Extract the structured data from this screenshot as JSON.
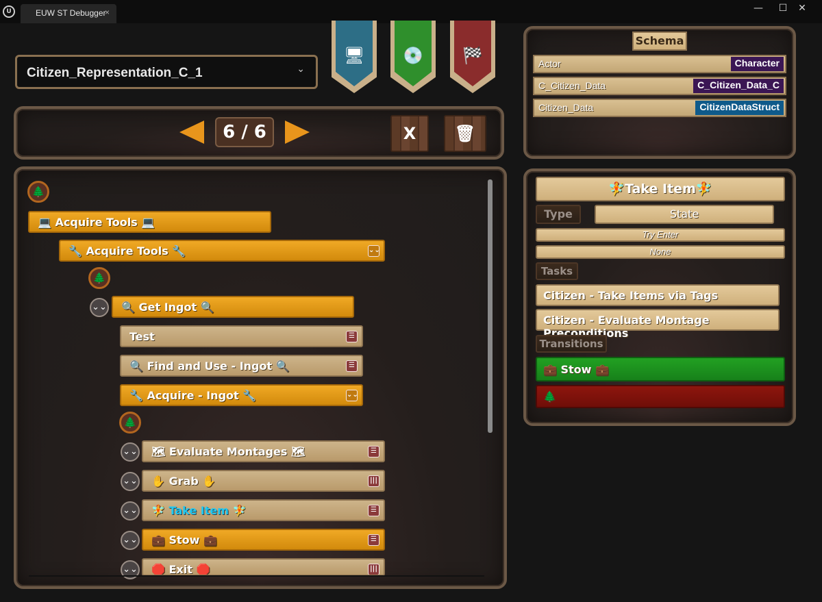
{
  "window": {
    "tab_title": "EUW ST Debugger",
    "tab_close": "×",
    "minimize": "—",
    "maximize": "☐",
    "close": "✕"
  },
  "selector": {
    "value": "Citizen_Representation_C_1",
    "chevron": "⌄"
  },
  "banners": [
    {
      "icon": "monitor-icon",
      "color": "#2d6e86",
      "glyph": "🖥"
    },
    {
      "icon": "disc-icon",
      "color": "#2f8f2c",
      "glyph": "💿"
    },
    {
      "icon": "checkered-flag-icon",
      "color": "#8a2c2c",
      "glyph": "🏁"
    }
  ],
  "nav": {
    "counter": "6 / 6",
    "clear_label": "X",
    "trash_glyph": "🗑"
  },
  "tree": {
    "root_glyph": "🌲",
    "nodes": [
      {
        "label": "Acquire Tools",
        "prefix": "💻",
        "suffix": "💻"
      },
      {
        "label": "Acquire Tools",
        "prefix": "🔧",
        "suffix": "🔧"
      },
      {
        "label": "Get Ingot",
        "prefix": "🔍",
        "suffix": "🔍"
      },
      {
        "label": "Test"
      },
      {
        "label": "Find and Use - Ingot",
        "prefix": "🔍",
        "suffix": "🔍"
      },
      {
        "label": "Acquire - Ingot",
        "prefix": "🔧",
        "suffix": "🔧"
      },
      {
        "label": "Evaluate Montages",
        "prefix": "🗺",
        "suffix": "🗺"
      },
      {
        "label": "Grab",
        "prefix": "✋",
        "suffix": "✋"
      },
      {
        "label": "Take Item",
        "prefix": "🧚",
        "suffix": "🧚"
      },
      {
        "label": "Stow",
        "prefix": "💼",
        "suffix": "💼"
      },
      {
        "label": "Exit",
        "prefix": "🛑",
        "suffix": "🛑"
      }
    ],
    "expand_glyph": "⌄⌄",
    "menu_glyph": "☰",
    "columns_glyph": "|||"
  },
  "schema": {
    "title": "Schema",
    "rows": [
      {
        "name": "Actor",
        "value": "Character",
        "color": "#3b1654"
      },
      {
        "name": "C_Citizen_Data",
        "value": "C_Citizen_Data_C",
        "color": "#3b1654"
      },
      {
        "name": "Citizen_Data",
        "value": "CitizenDataStruct",
        "color": "#0f5a8a"
      }
    ]
  },
  "details": {
    "title": "Take Item",
    "title_glyph": "🧚",
    "type_label": "Type",
    "type_value": "State",
    "enter_condition": "Try Enter",
    "selection": "None",
    "tasks_label": "Tasks",
    "tasks": [
      "Citizen - Take Items via Tags",
      "Citizen - Evaluate Montage Preconditions"
    ],
    "transitions_label": "Transitions",
    "transition_success": {
      "label": "Stow",
      "glyph": "💼"
    },
    "transition_fail": {
      "glyph": "🌲"
    }
  }
}
